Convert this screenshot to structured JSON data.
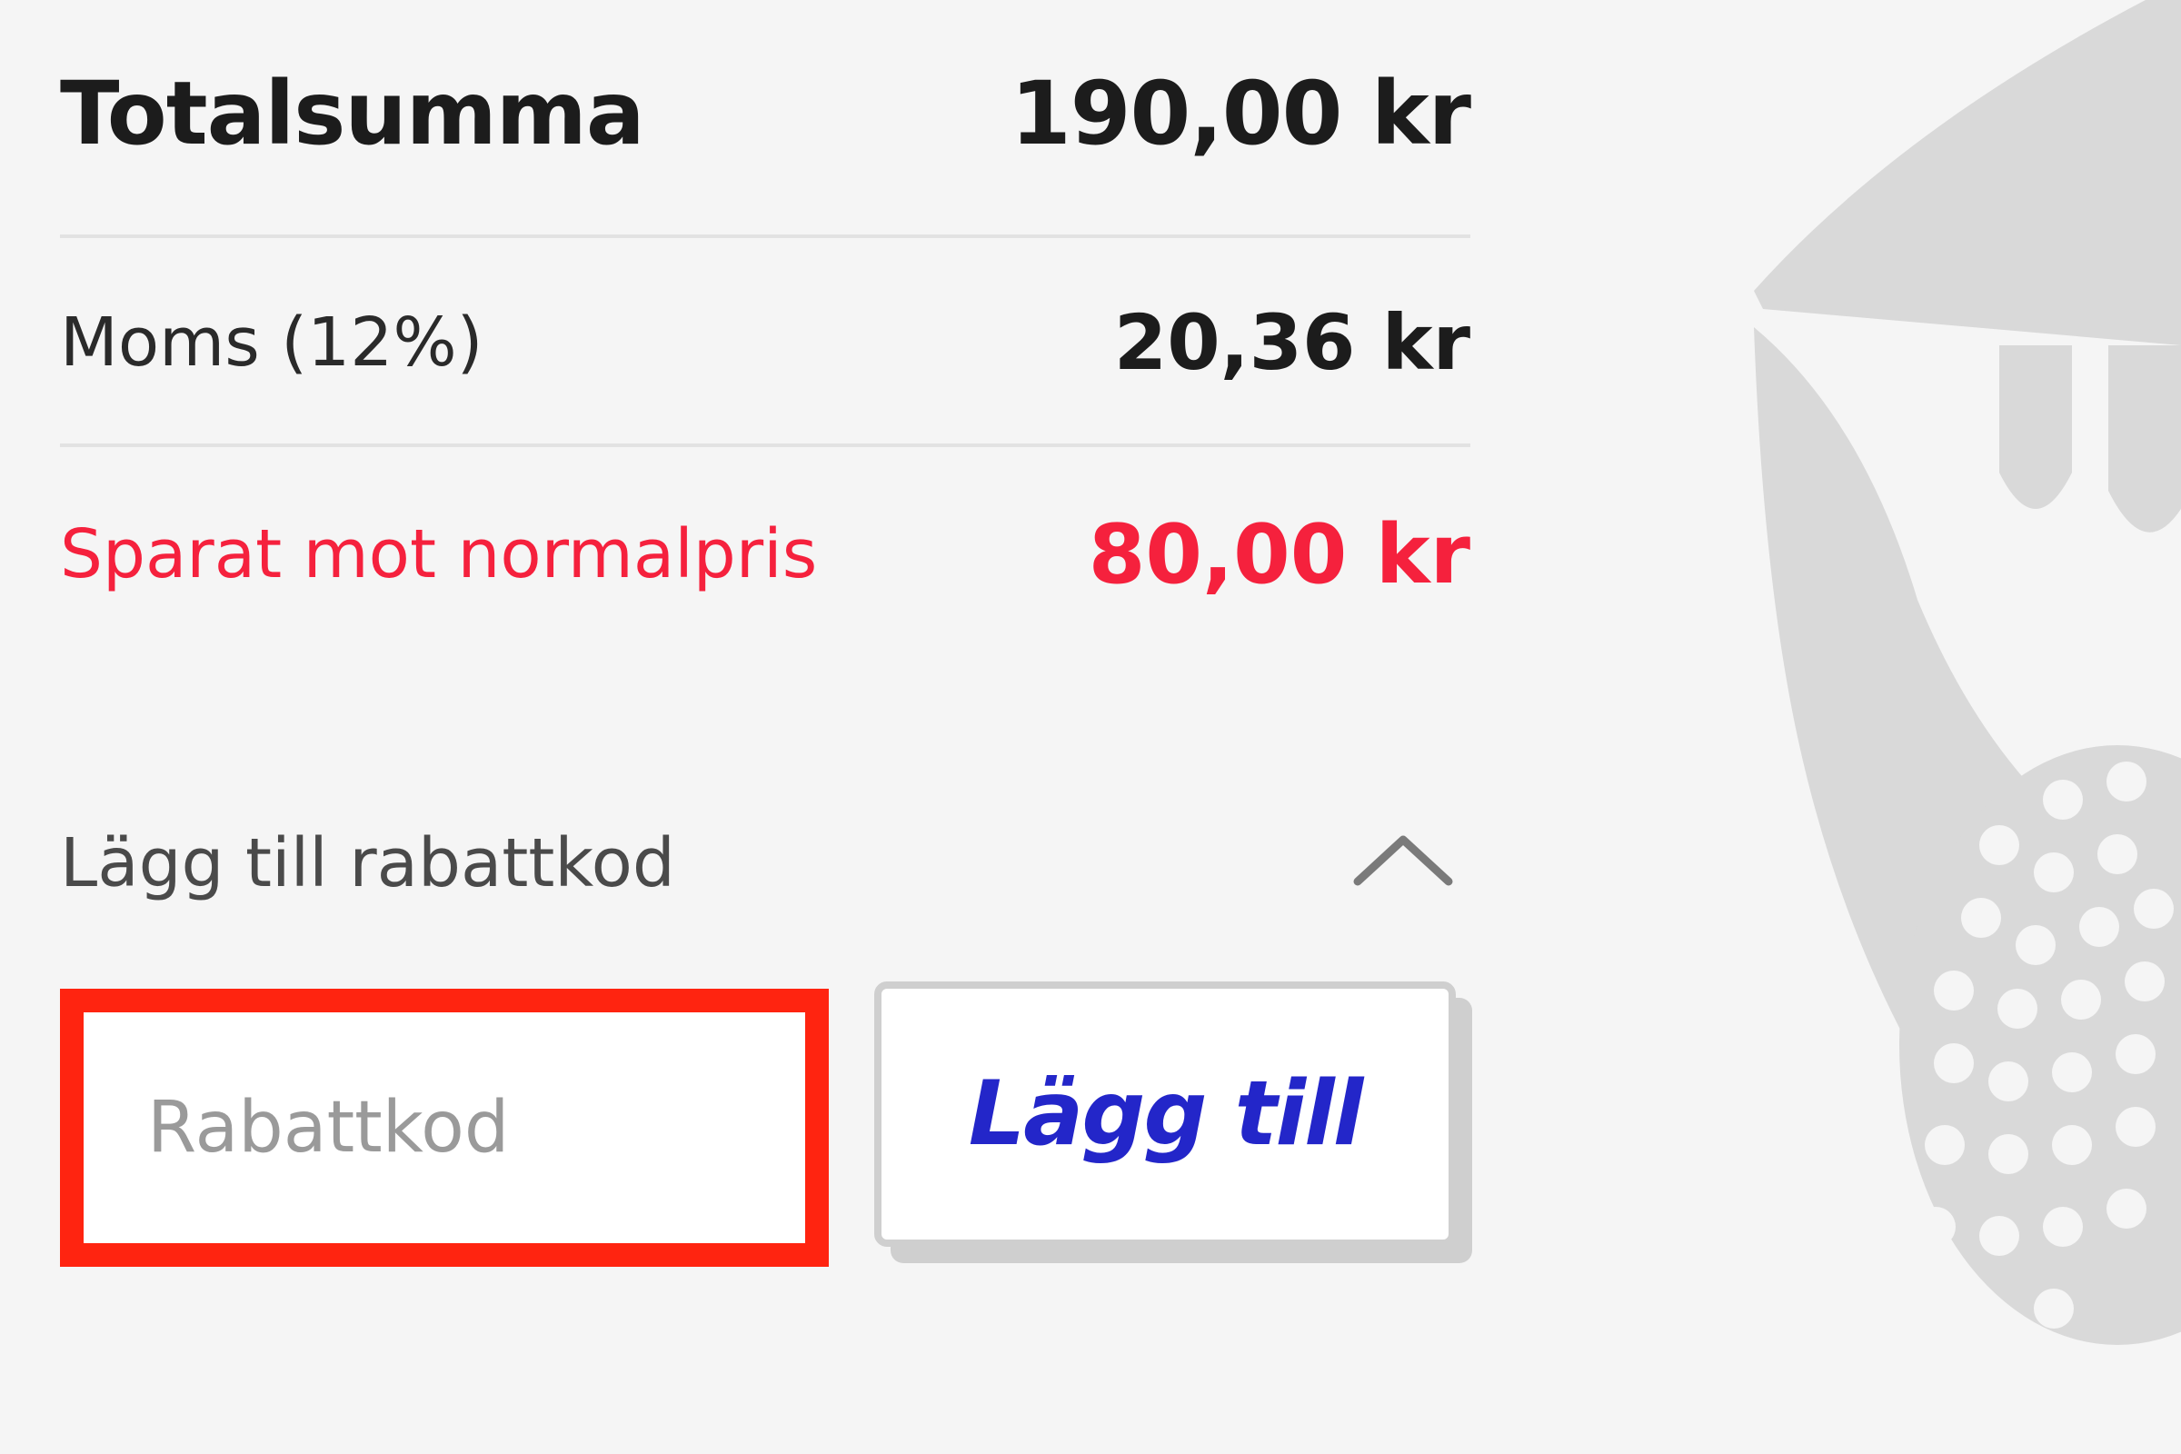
{
  "summary": {
    "total_label": "Totalsumma",
    "total_value": "190,00 kr",
    "vat_label": "Moms (12%)",
    "vat_value": "20,36 kr",
    "saved_label": "Sparat mot normalpris",
    "saved_value": "80,00 kr"
  },
  "discount": {
    "toggle_label": "Lägg till rabattkod",
    "toggle_icon": "chevron-up-icon",
    "input_placeholder": "Rabattkod",
    "input_value": "",
    "button_label": "Lägg till"
  },
  "colors": {
    "background": "#f5f5f5",
    "text": "#1c1c1c",
    "saved": "#f5213d",
    "input_focus_border": "#ff2410",
    "button_text": "#2326c9",
    "mascot": "#d9d9d9"
  },
  "decoration": {
    "mascot_icon": "mascot-illustration"
  }
}
